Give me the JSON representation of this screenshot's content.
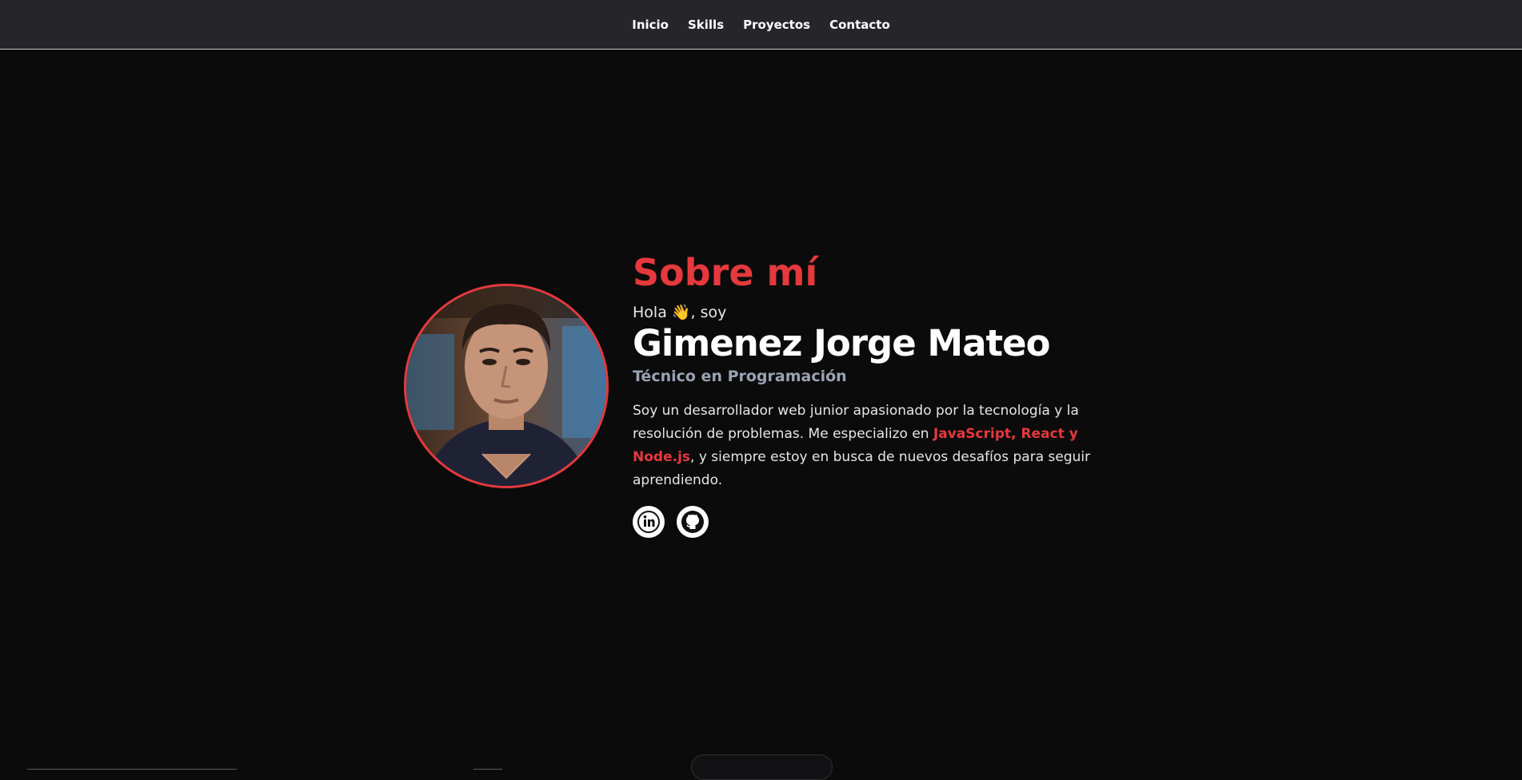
{
  "nav": {
    "items": [
      "Inicio",
      "Skills",
      "Proyectos",
      "Contacto"
    ]
  },
  "about": {
    "title": "Sobre mí",
    "greeting": "Hola 👋, soy",
    "name": "Gimenez Jorge Mateo",
    "role": "Técnico en Programación",
    "description_prefix": "Soy un desarrollador web junior apasionado por la tecnología y la resolución de problemas. Me especializo en ",
    "highlight_1": "JavaScript",
    "highlight_sep": ", ",
    "highlight_2": "React y Node.js",
    "description_suffix": ", y siempre estoy en busca de nuevos desafíos para seguir aprendiendo."
  },
  "social": {
    "items": [
      {
        "icon": "linkedin-icon"
      },
      {
        "icon": "github-icon"
      }
    ]
  },
  "colors": {
    "accent": "#e5393d",
    "navbar": "#26262a",
    "background": "#0c0b0b",
    "role": "#9aa3b5"
  }
}
